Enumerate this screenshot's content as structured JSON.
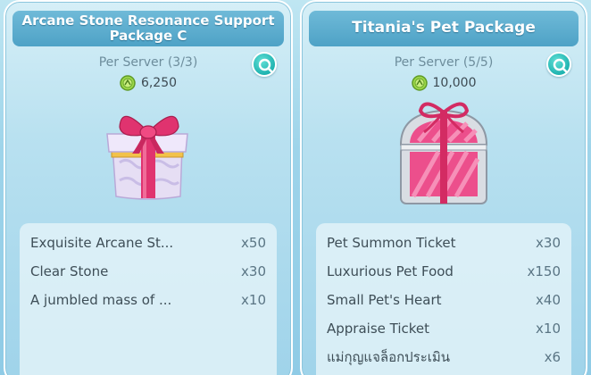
{
  "cards": [
    {
      "title": "Arcane Stone Resonance Support Package C",
      "purchase_limit": "Per Server (3/3)",
      "price": "6,250",
      "items": [
        {
          "name": "Exquisite Arcane St...",
          "qty": "x50"
        },
        {
          "name": "Clear Stone",
          "qty": "x30"
        },
        {
          "name": "A jumbled mass of ...",
          "qty": "x10"
        }
      ]
    },
    {
      "title": "Titania's Pet Package",
      "purchase_limit": "Per Server (5/5)",
      "price": "10,000",
      "items": [
        {
          "name": "Pet Summon Ticket",
          "qty": "x30"
        },
        {
          "name": "Luxurious Pet Food",
          "qty": "x150"
        },
        {
          "name": "Small Pet's Heart",
          "qty": "x40"
        },
        {
          "name": "Appraise Ticket",
          "qty": "x10"
        },
        {
          "name": "แม่กุญแจล็อกประเมิน",
          "qty": "x6"
        }
      ]
    }
  ],
  "icons": {
    "zoom": "magnifier-icon",
    "currency": "green-coin-icon",
    "package1": "purple-gift-box-icon",
    "package2": "pink-treasure-chest-icon"
  },
  "colors": {
    "title_bar": "#4ea2c6",
    "zoom_button": "#1fb3b0",
    "coin": "#7cc23a",
    "ribbon": "#e0336f"
  }
}
